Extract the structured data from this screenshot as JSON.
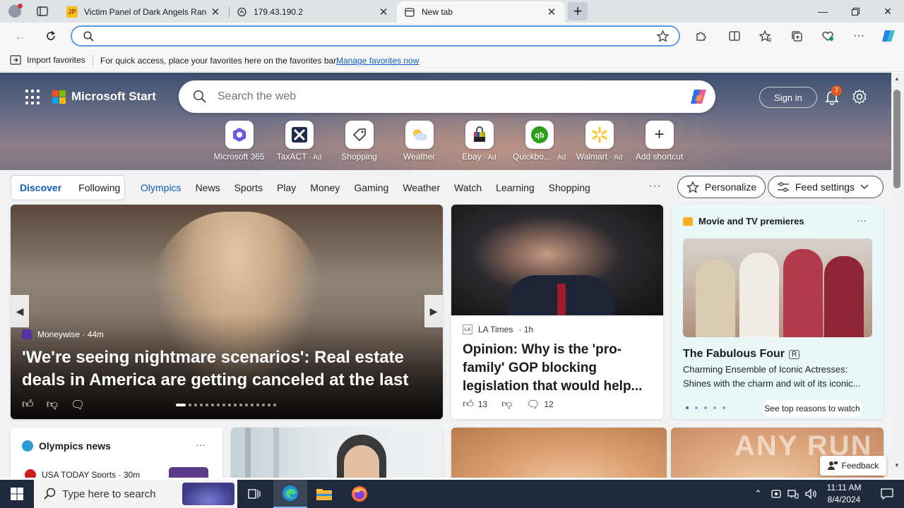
{
  "tabs": [
    {
      "title": "Victim Panel of Dark Angels Ran",
      "favicon": "JP",
      "active": false
    },
    {
      "title": "179.43.190.2",
      "favicon": "document-icon",
      "active": false
    },
    {
      "title": "New tab",
      "favicon": "newtab-icon",
      "active": true
    }
  ],
  "omnibox": {
    "value": "",
    "placeholder": ""
  },
  "favorites_bar": {
    "import_label": "Import favorites",
    "message": "For quick access, place your favorites here on the favorites bar.",
    "link": "Manage favorites now"
  },
  "header": {
    "brand": "Microsoft Start",
    "search_placeholder": "Search the web",
    "signin": "Sign in",
    "notification_count": "7"
  },
  "shortcuts": [
    {
      "label": "Microsoft 365",
      "ad": ""
    },
    {
      "label": "TaxACT",
      "ad": "· Ad"
    },
    {
      "label": "Shopping",
      "ad": ""
    },
    {
      "label": "Weather",
      "ad": ""
    },
    {
      "label": "Ebay",
      "ad": "· Ad"
    },
    {
      "label": "Quickbo...",
      "ad": "· Ad"
    },
    {
      "label": "Walmart",
      "ad": "· Ad"
    },
    {
      "label": "Add shortcut",
      "ad": ""
    }
  ],
  "feed_nav": {
    "discover": "Discover",
    "following": "Following",
    "categories": [
      "Olympics",
      "News",
      "Sports",
      "Play",
      "Money",
      "Gaming",
      "Weather",
      "Watch",
      "Learning",
      "Shopping"
    ],
    "more": "···",
    "personalize": "Personalize",
    "feed_settings": "Feed settings"
  },
  "big_story": {
    "source": "Moneywise · 44m",
    "title": "'We're seeing nightmare scenarios': Real estate deals in America are getting canceled at the last minute ..."
  },
  "news_story": {
    "source": "LA Times",
    "time": "· 1h",
    "title": "Opinion: Why is the 'pro-family' GOP blocking legislation that would help...",
    "likes": "13",
    "comments": "12"
  },
  "movie_card": {
    "heading": "Movie and TV premieres",
    "title": "The Fabulous Four",
    "rating": "R",
    "description": "Charming Ensemble of Iconic Actresses: Shines with the charm and wit of its iconic...",
    "cta": "See top reasons to watch"
  },
  "olympics": {
    "heading": "Olympics news",
    "item_source": "USA TODAY Sports · 30m"
  },
  "watermark": "ANY RUN",
  "feedback": "Feedback",
  "taskbar": {
    "search_placeholder": "Type here to search",
    "time": "11:11 AM",
    "date": "8/4/2024"
  },
  "colors": {
    "accent": "#0f5cba",
    "taskbar": "#1f2a3c",
    "omnibox_border": "#5e9be6"
  }
}
